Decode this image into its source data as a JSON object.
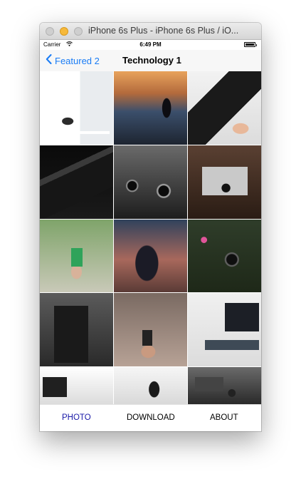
{
  "window": {
    "title": "iPhone 6s Plus - iPhone 6s Plus / iO..."
  },
  "status_bar": {
    "carrier": "Carrier",
    "time": "6:49 PM"
  },
  "nav": {
    "back_label": "Featured 2",
    "title": "Technology 1"
  },
  "grid": {
    "photos": [
      {
        "name": "photo-desk-imac",
        "scene": "desk-imac"
      },
      {
        "name": "photo-sunset-photographer",
        "scene": "sunset-photographer"
      },
      {
        "name": "photo-hand-camera",
        "scene": "hand-camera"
      },
      {
        "name": "photo-dark-laptop",
        "scene": "dark-laptop"
      },
      {
        "name": "photo-vintage-cameras",
        "scene": "vintage-cameras"
      },
      {
        "name": "photo-retro-camera",
        "scene": "retro-camera"
      },
      {
        "name": "photo-phone-street",
        "scene": "phone-street"
      },
      {
        "name": "photo-night-phone",
        "scene": "night-phone"
      },
      {
        "name": "photo-camera-lens-flowers",
        "scene": "lens-flowers"
      },
      {
        "name": "photo-dark-pc-tower",
        "scene": "pc-tower"
      },
      {
        "name": "photo-hand-phone-closeup",
        "scene": "hand-phone"
      },
      {
        "name": "photo-tv-room",
        "scene": "tv-room"
      },
      {
        "name": "photo-office-monitor",
        "scene": "office-monitor"
      },
      {
        "name": "photo-headphones",
        "scene": "headphones"
      },
      {
        "name": "photo-car-smartwatch",
        "scene": "car-watch"
      }
    ]
  },
  "tab_bar": {
    "tabs": [
      {
        "label": "PHOTO",
        "active": true
      },
      {
        "label": "DOWNLOAD",
        "active": false
      },
      {
        "label": "ABOUT",
        "active": false
      }
    ]
  },
  "colors": {
    "accent": "#1a7cf5",
    "active_tab": "#1a1aa8"
  }
}
